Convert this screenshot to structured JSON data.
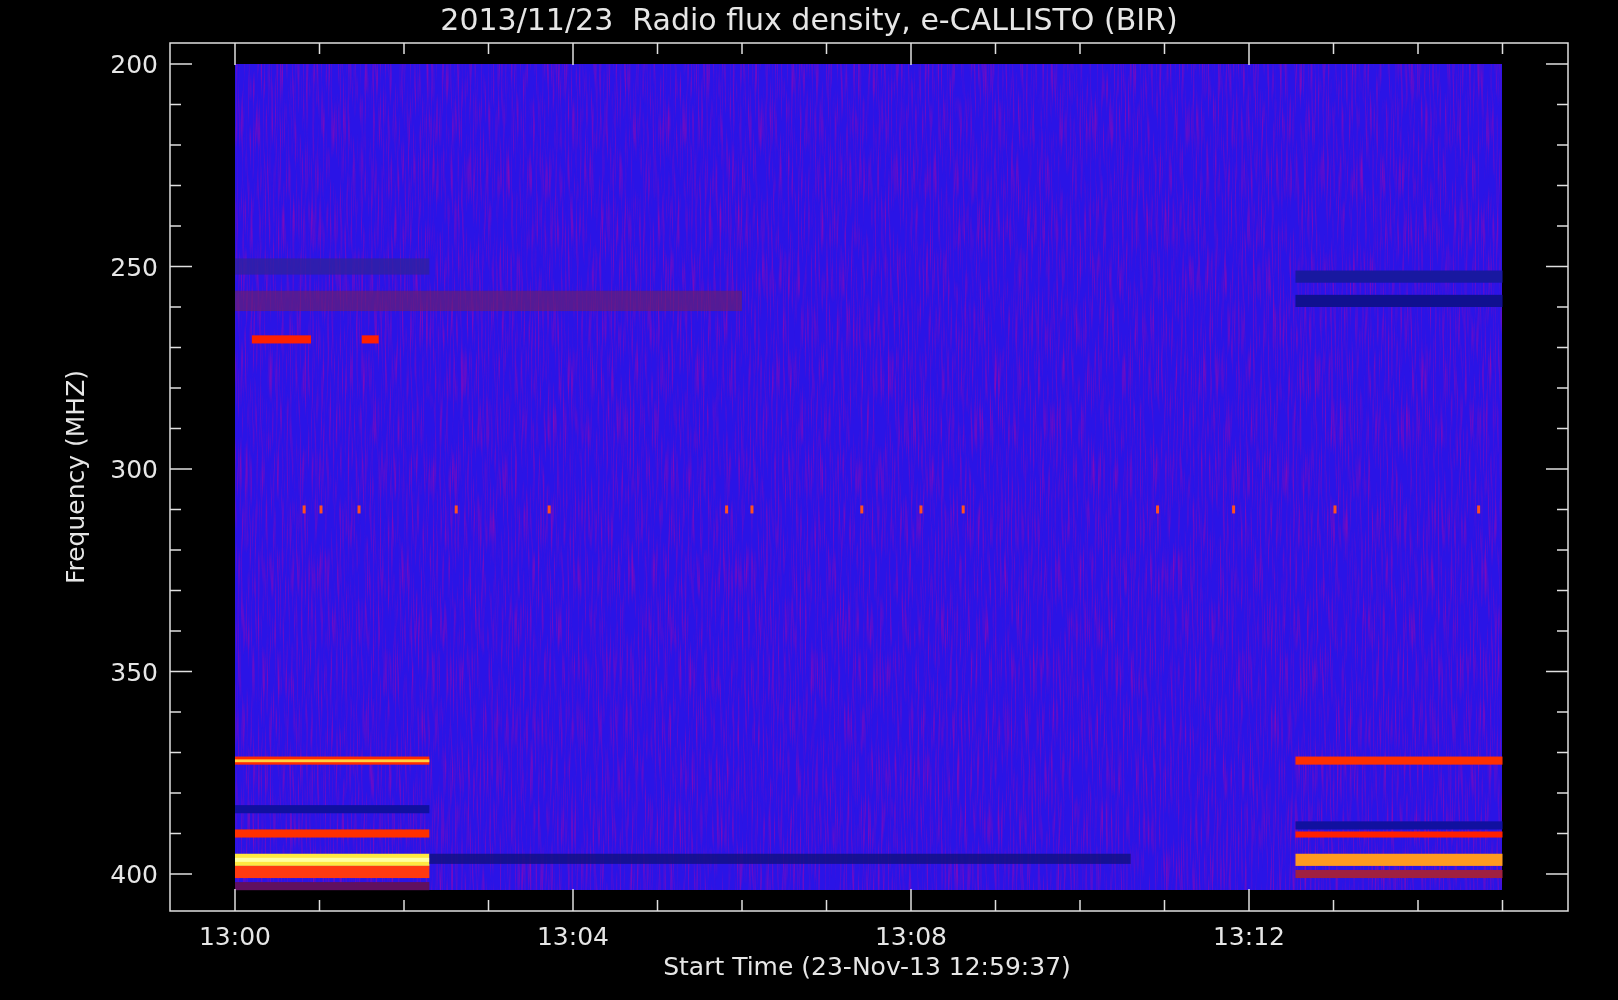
{
  "title": "2013/11/23  Radio flux density, e-CALLISTO (BIR)",
  "y_axis": {
    "label": "Frequency (MHZ)",
    "ticks": [
      "200",
      "250",
      "300",
      "350",
      "400"
    ]
  },
  "x_axis": {
    "label": "Start Time (23-Nov-13 12:59:37)",
    "ticks": [
      "13:00",
      "13:04",
      "13:08",
      "13:12"
    ]
  }
}
